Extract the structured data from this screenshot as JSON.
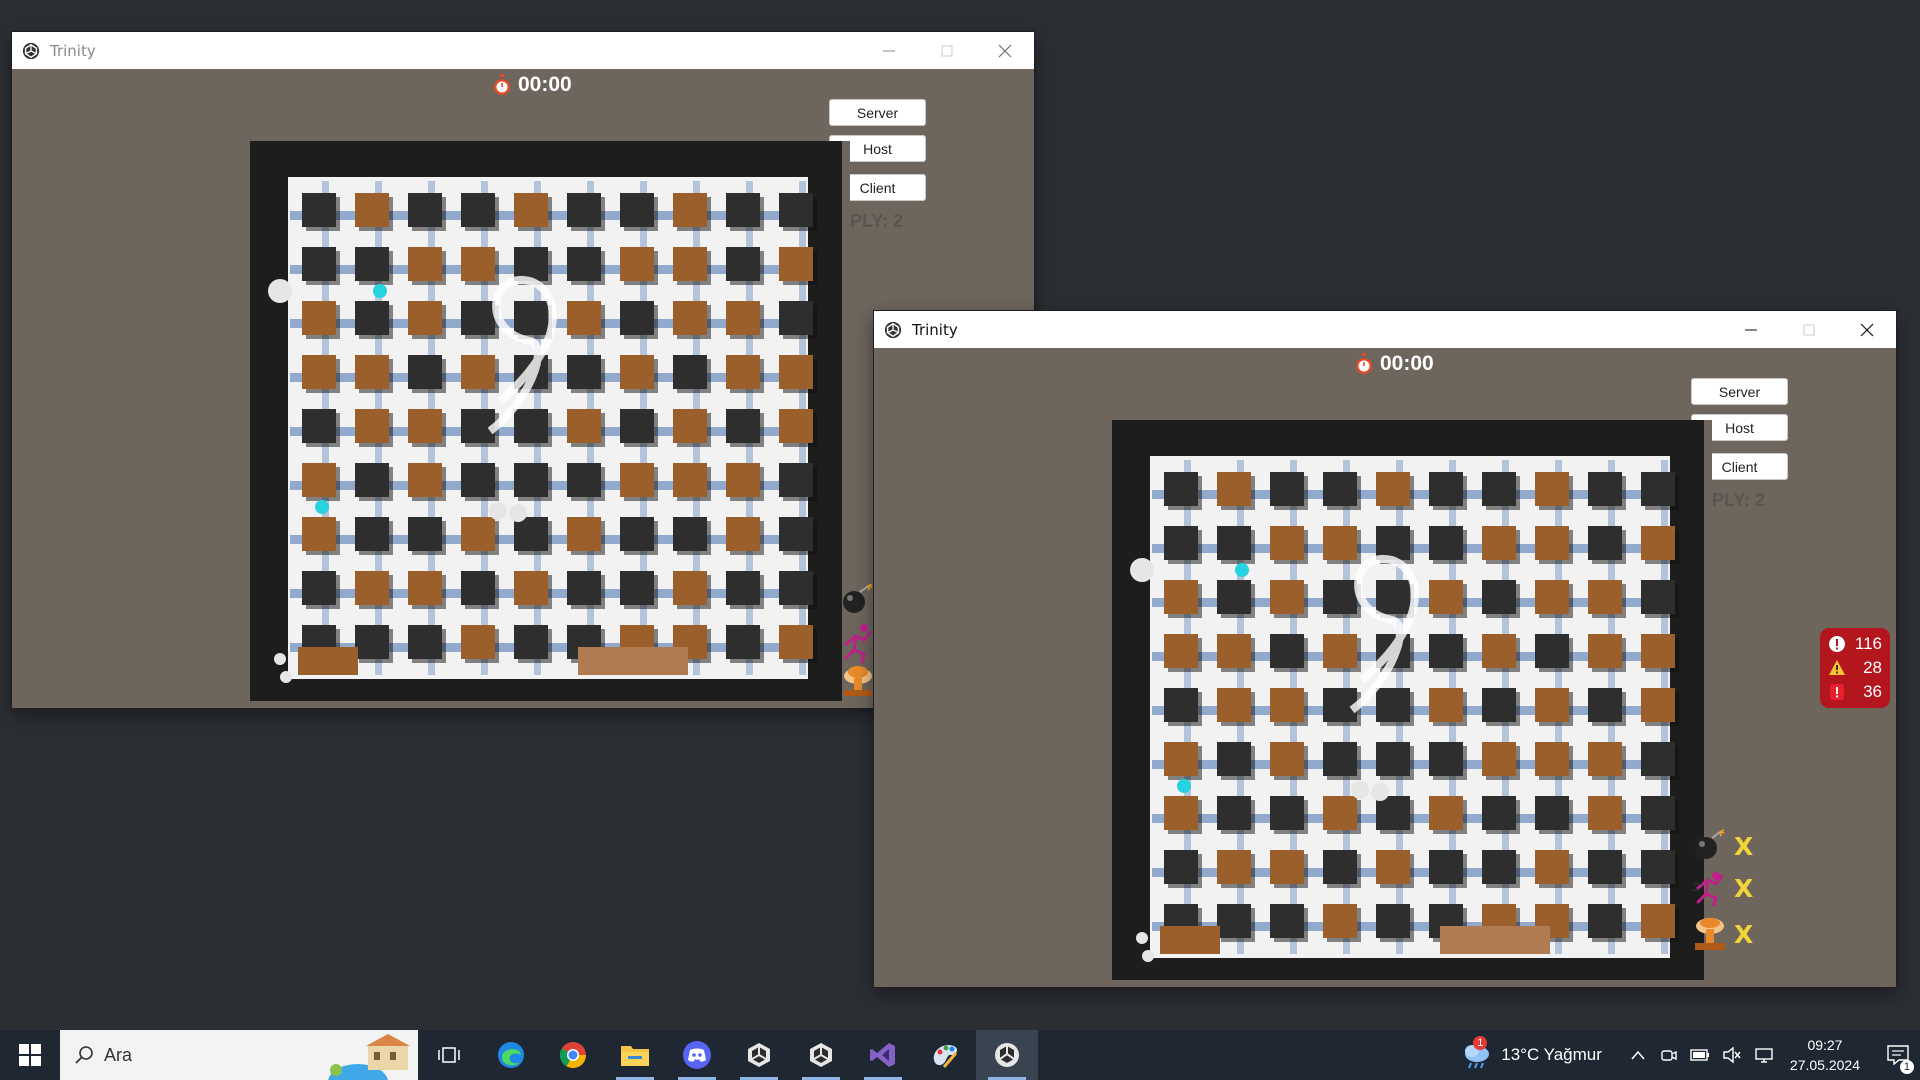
{
  "windows": [
    {
      "id": "back",
      "title": "Trinity",
      "timer": "00:00",
      "buttons": {
        "server": "Server",
        "host": "Host",
        "client": "Client"
      },
      "players": "PLY: 2"
    },
    {
      "id": "front",
      "title": "Trinity",
      "timer": "00:00",
      "buttons": {
        "server": "Server",
        "host": "Host",
        "client": "Client"
      },
      "players": "PLY: 2",
      "powerups": [
        {
          "icon": "bomb-icon",
          "status": "X"
        },
        {
          "icon": "runner-icon",
          "status": "X"
        },
        {
          "icon": "explosion-icon",
          "status": "X"
        }
      ],
      "diagnostics": {
        "errors": "116",
        "warnings": "28",
        "messages": "36"
      }
    }
  ],
  "taskbar": {
    "search_placeholder": "Ara",
    "apps": [
      "task-view-icon",
      "edge-icon",
      "chrome-icon",
      "file-explorer-icon",
      "discord-icon",
      "unity-icon",
      "unity-icon",
      "visual-studio-icon",
      "paint-icon",
      "unity-player-icon"
    ],
    "weather": "13°C Yağmur",
    "weather_badge": "1",
    "time": "09:27",
    "date": "27.05.2024",
    "notification_count": "1"
  },
  "colors": {
    "desktop": "#2b2e33",
    "game_bg": "#6e655c",
    "floor": "#f2f2f2",
    "path": "#7f9cc6",
    "wood": "#9a5f2a",
    "block": "#2e2e2e",
    "badge_red": "#b3161d",
    "powerup_x": "#f3d23a"
  }
}
